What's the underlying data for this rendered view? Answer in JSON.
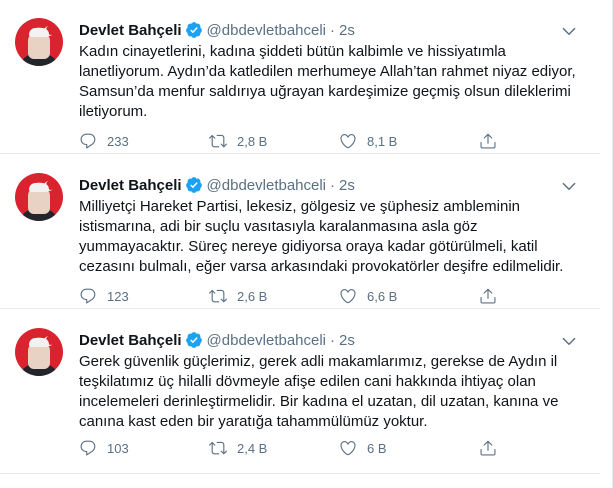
{
  "tweets": [
    {
      "name": "Devlet Bahçeli",
      "handle": "@dbdevletbahceli",
      "dot": "·",
      "time": "2s",
      "text": "Kadın cinayetlerini, kadına şiddeti bütün kalbimle ve hissiyatımla lanetliyorum. Aydın’da katledilen merhumeye Allah’tan rahmet niyaz ediyor, Samsun’da menfur saldırıya uğrayan kardeşimize geçmiş olsun dileklerimi iletiyorum.",
      "replies": "233",
      "retweets": "2,8 B",
      "likes": "8,1 B"
    },
    {
      "name": "Devlet Bahçeli",
      "handle": "@dbdevletbahceli",
      "dot": "·",
      "time": "2s",
      "text": "Milliyetçi Hareket Partisi, lekesiz, gölgesiz ve şüphesiz ambleminin istismarına, adi bir suçlu vasıtasıyla karalanmasına asla göz yummayacaktır. Süreç nereye gidiyorsa oraya kadar götürülmeli, katil cezasını bulmalı, eğer varsa arkasındaki provokatörler deşifre edilmelidir.",
      "replies": "123",
      "retweets": "2,6 B",
      "likes": "6,6 B"
    },
    {
      "name": "Devlet Bahçeli",
      "handle": "@dbdevletbahceli",
      "dot": "·",
      "time": "2s",
      "text": "Gerek güvenlik güçlerimiz, gerek adli makamlarımız, gerekse de Aydın il teşkilatımız üç hilalli dövmeyle afişe edilen cani hakkında ihtiyaç olan incelemeleri derinleştirmelidir. Bir kadına el uzatan, dil uzatan, kanına ve canına kast eden bir yaratığa tahammülümüz yoktur.",
      "replies": "103",
      "retweets": "2,4 B",
      "likes": "6 B"
    }
  ],
  "icons": {
    "verified": "verified-badge-icon",
    "caret": "caret-down-icon",
    "reply": "reply-icon",
    "retweet": "retweet-icon",
    "like": "heart-icon",
    "share": "share-icon"
  },
  "colors": {
    "accent": "#1da1f2",
    "muted": "#5b7083",
    "divider": "#e6ecf0",
    "text": "#0f1419"
  }
}
